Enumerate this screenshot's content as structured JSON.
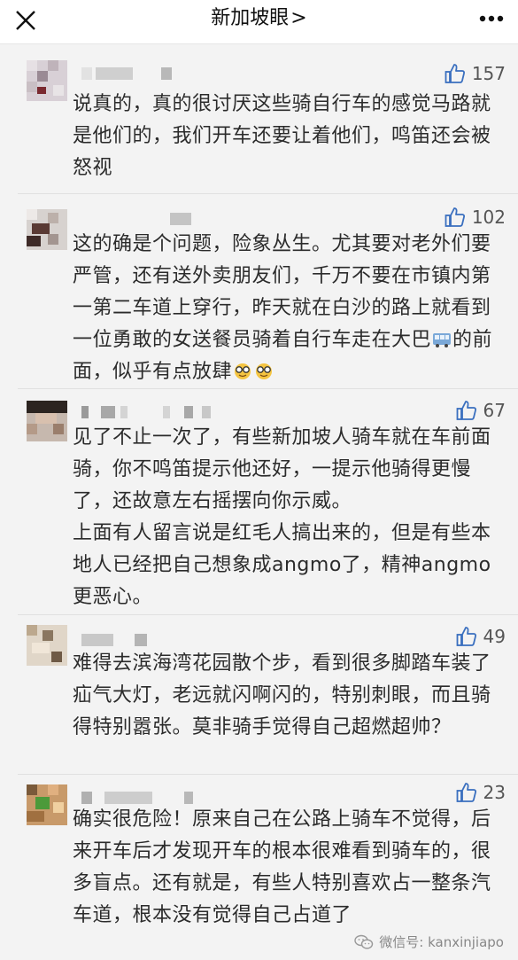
{
  "header": {
    "title": "新加坡眼",
    "chevron": ">",
    "close_icon": "close-icon",
    "more_icon": "more-icon"
  },
  "comments": [
    {
      "likes": "157",
      "text": "说真的，真的很讨厌这些骑自行车的感觉马路就是他们的，我们开车还要让着他们，鸣笛还会被怒视"
    },
    {
      "likes": "102",
      "text_part1": "这的确是个问题，险象丛生。尤其要对老外们要严管，还有送外卖朋友们，千万不要在市镇内第一第二车道上穿行，昨天就在白沙的路上就看到一位勇敢的女送餐员骑着自行车走在大巴",
      "text_part2": "的前面，似乎有点放肆"
    },
    {
      "likes": "67",
      "text": "见了不止一次了，有些新加坡人骑车就在车前面骑，你不鸣笛提示他还好，一提示他骑得更慢了，还故意左右摇摆向你示威。\n上面有人留言说是红毛人搞出来的，但是有些本地人已经把自己想象成angmo了，精神angmo更恶心。"
    },
    {
      "likes": "49",
      "text": "难得去滨海湾花园散个步，看到很多脚踏车装了疝气大灯，老远就闪啊闪的，特别刺眼，而且骑得特别嚣张。莫非骑手觉得自己超燃超帅？"
    },
    {
      "likes": "23",
      "text": "确实很危险！原来自己在公路上骑车不觉得，后来开车后才发现开车的根本很难看到骑车的，很多盲点。还有就是，有些人特别喜欢占一整条汽车道，根本没有觉得自己占道了"
    }
  ],
  "watermark": {
    "text": "微信号: kanxinjiapo",
    "icon": "wechat-icon"
  }
}
